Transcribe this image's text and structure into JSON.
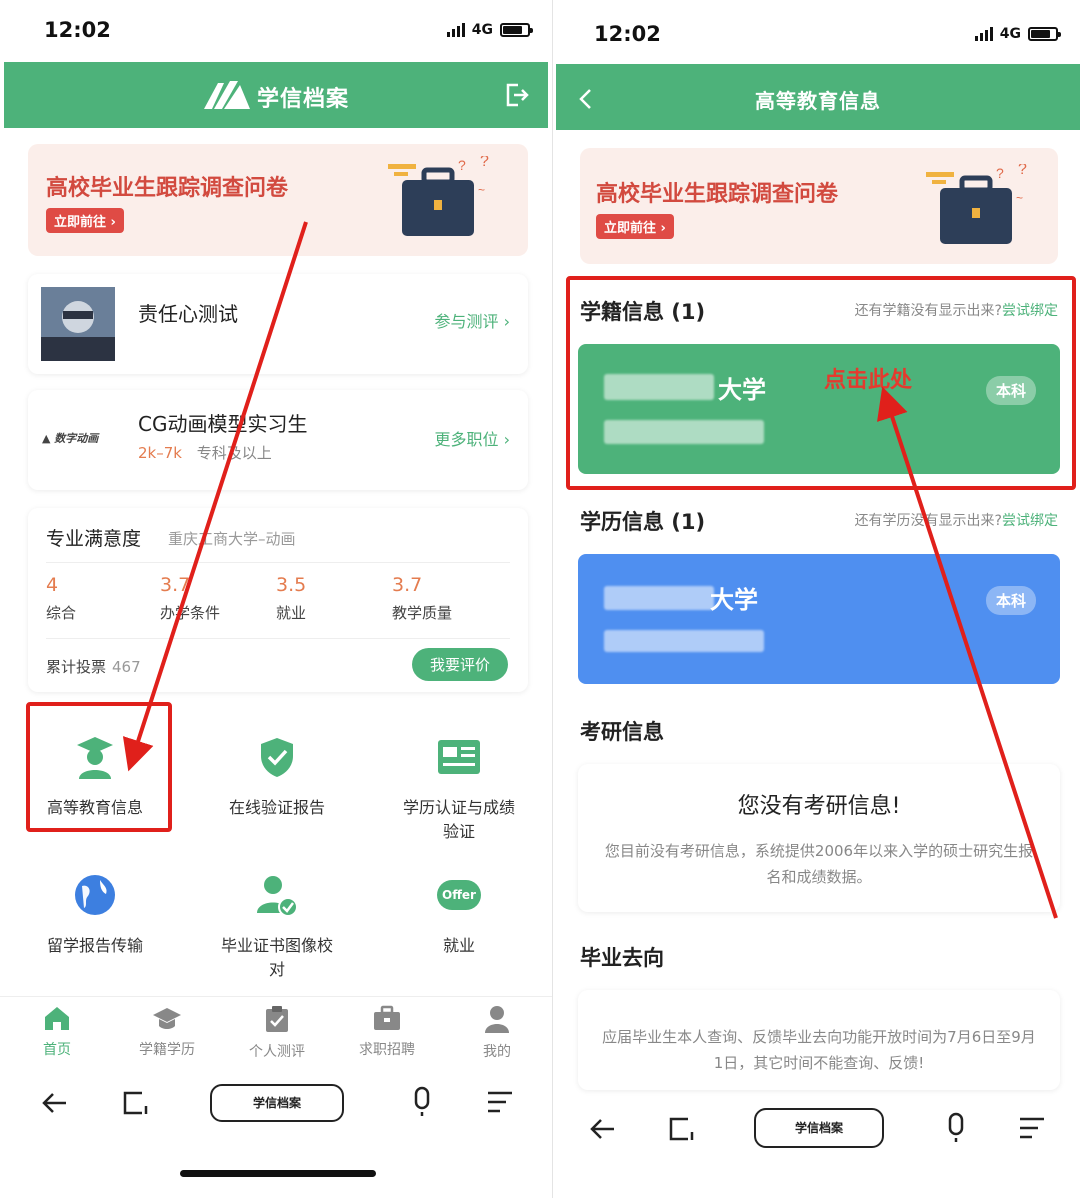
{
  "status": {
    "time": "12:02",
    "network": "4G"
  },
  "left": {
    "app_title": "学信档案",
    "banner": {
      "title": "高校毕业生跟踪调查问卷",
      "button": "立即前往 ›"
    },
    "survey": {
      "title": "责任心测试",
      "link": "参与测评 ›"
    },
    "job": {
      "title": "CG动画模型实习生",
      "salary": "2k–7k",
      "req": "专科及以上",
      "link": "更多职位 ›"
    },
    "satisfaction": {
      "title": "专业满意度",
      "school": "重庆工商大学–动画",
      "items": [
        {
          "value": "4",
          "label": "综合"
        },
        {
          "value": "3.7",
          "label": "办学条件"
        },
        {
          "value": "3.5",
          "label": "就业"
        },
        {
          "value": "3.7",
          "label": "教学质量"
        }
      ],
      "votes_label": "累计投票",
      "votes": "467",
      "rate_button": "我要评价"
    },
    "grid": [
      {
        "label": "高等教育信息",
        "icon": "graduate-icon"
      },
      {
        "label": "在线验证报告",
        "icon": "shield-check-icon"
      },
      {
        "label": "学历认证与成绩验证",
        "icon": "id-card-icon"
      },
      {
        "label": "留学报告传输",
        "icon": "globe-icon"
      },
      {
        "label": "毕业证书图像校对",
        "icon": "user-check-icon"
      },
      {
        "label": "就业",
        "icon": "offer-icon",
        "icon_text": "Offer"
      }
    ],
    "tabs": [
      {
        "label": "首页",
        "icon": "home-icon",
        "active": true
      },
      {
        "label": "学籍学历",
        "icon": "mortarboard-icon"
      },
      {
        "label": "个人测评",
        "icon": "clipboard-icon"
      },
      {
        "label": "求职招聘",
        "icon": "briefcase-icon"
      },
      {
        "label": "我的",
        "icon": "person-icon"
      }
    ],
    "nav_pill": "学信档案"
  },
  "right": {
    "app_title": "高等教育信息",
    "banner": {
      "title": "高校毕业生跟踪调查问卷",
      "button": "立即前往 ›"
    },
    "xueji": {
      "title": "学籍信息 (1)",
      "hint": "还有学籍没有显示出来?",
      "hint_link": "尝试绑定",
      "univ": "大学",
      "badge": "本科",
      "annotation": "点击此处"
    },
    "xueli": {
      "title": "学历信息 (1)",
      "hint": "还有学历没有显示出来?",
      "hint_link": "尝试绑定",
      "univ": "大学",
      "badge": "本科"
    },
    "kaoyan": {
      "title": "考研信息",
      "empty_title": "您没有考研信息!",
      "empty_desc": "您目前没有考研信息，系统提供2006年以来入学的硕士研究生报名和成绩数据。"
    },
    "biye": {
      "title": "毕业去向",
      "desc": "应届毕业生本人查询、反馈毕业去向功能开放时间为7月6日至9月1日，其它时间不能查询、反馈!"
    },
    "nav_pill": "学信档案"
  },
  "colors": {
    "primary": "#4db27a",
    "accent_red": "#e0201b",
    "card_blue": "#4f8ff0",
    "orange": "#e47c4f"
  }
}
